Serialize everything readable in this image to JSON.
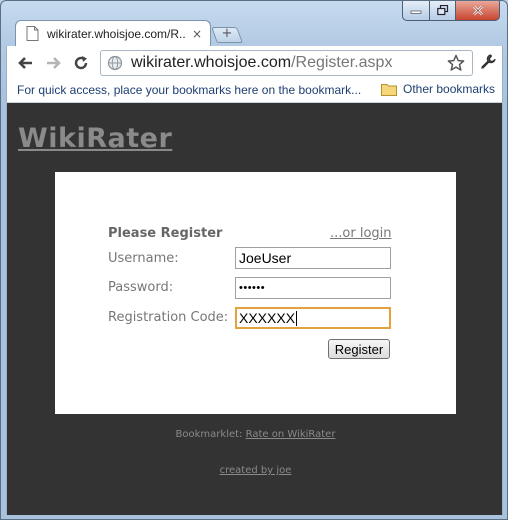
{
  "window": {
    "controls": {
      "minimize_icon": "minimize-icon",
      "maximize_icon": "maximize-icon",
      "close_icon": "close-icon"
    }
  },
  "tab": {
    "title": "wikirater.whoisjoe.com/R...",
    "close": "×",
    "favicon": "page-icon"
  },
  "new_tab": {
    "icon": "plus-icon",
    "glyph": "+"
  },
  "toolbar": {
    "back_icon": "back-arrow-icon",
    "forward_icon": "forward-arrow-icon",
    "reload_icon": "reload-icon",
    "url_host": "wikirater.whoisjoe.com",
    "url_path": "/Register.aspx",
    "star_icon": "star-icon",
    "wrench_icon": "wrench-icon"
  },
  "bookmarks": {
    "hint": "For quick access, place your bookmarks here on the bookmark...",
    "other_label": "Other bookmarks",
    "other_icon": "folder-icon"
  },
  "page": {
    "logo": "WikiRater",
    "form": {
      "title": "Please Register",
      "login_link": "...or login",
      "username_label": "Username:",
      "username_value": "JoeUser",
      "password_label": "Password:",
      "password_value": "••••••",
      "regcode_label": "Registration Code:",
      "regcode_value": "XXXXXX",
      "register_button": "Register"
    },
    "footer": {
      "bookmarklet_label": "Bookmarklet:",
      "bookmarklet_link": "Rate on WikiRater",
      "credit": "created by joe"
    }
  },
  "colors": {
    "page_background": "#333333",
    "card_background": "#ffffff",
    "logo": "#8a8a8a",
    "focus_outline": "#e3a23d",
    "bookmark_text": "#1d3f72"
  }
}
